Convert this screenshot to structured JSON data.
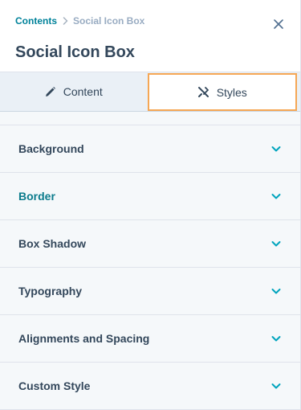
{
  "breadcrumb": {
    "parent": "Contents",
    "current": "Social Icon Box"
  },
  "title": "Social Icon Box",
  "tabs": [
    {
      "label": "Content",
      "icon": "pencil-icon",
      "active": false
    },
    {
      "label": "Styles",
      "icon": "styles-icon",
      "active": true
    }
  ],
  "sections": [
    {
      "label": "Background"
    },
    {
      "label": "Border"
    },
    {
      "label": "Box Shadow"
    },
    {
      "label": "Typography"
    },
    {
      "label": "Alignments and Spacing"
    },
    {
      "label": "Custom Style"
    }
  ],
  "colors": {
    "accent": "#00a4bd",
    "link": "#00829a",
    "text": "#33475b",
    "active_tab_border": "#f5a755"
  }
}
